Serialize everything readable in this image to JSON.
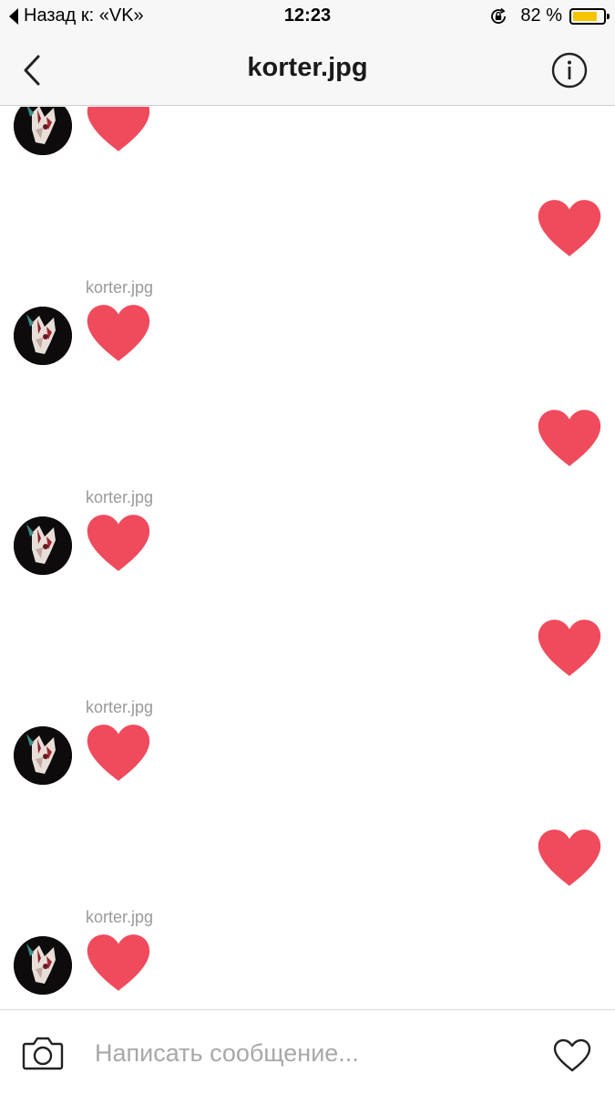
{
  "status_bar": {
    "back_app": "Назад к: «VK»",
    "time": "12:23",
    "battery_percent": "82 %",
    "battery_level": 0.82,
    "battery_color": "#f5c400"
  },
  "nav": {
    "title": "korter.jpg",
    "back_icon": "chevron-left-icon",
    "info_icon": "info-circle-icon"
  },
  "messages": [
    {
      "direction": "incoming",
      "sender": "",
      "content": "heart-icon"
    },
    {
      "direction": "outgoing",
      "content": "heart-icon"
    },
    {
      "direction": "incoming",
      "sender": "korter.jpg",
      "content": "heart-icon"
    },
    {
      "direction": "outgoing",
      "content": "heart-icon"
    },
    {
      "direction": "incoming",
      "sender": "korter.jpg",
      "content": "heart-icon"
    },
    {
      "direction": "outgoing",
      "content": "heart-icon"
    },
    {
      "direction": "incoming",
      "sender": "korter.jpg",
      "content": "heart-icon"
    },
    {
      "direction": "outgoing",
      "content": "heart-icon"
    },
    {
      "direction": "incoming",
      "sender": "korter.jpg",
      "content": "heart-icon"
    }
  ],
  "heart_color": "#ef4b5c",
  "composer": {
    "placeholder": "Написать сообщение...",
    "camera_icon": "camera-icon",
    "like_icon": "heart-outline-icon"
  }
}
